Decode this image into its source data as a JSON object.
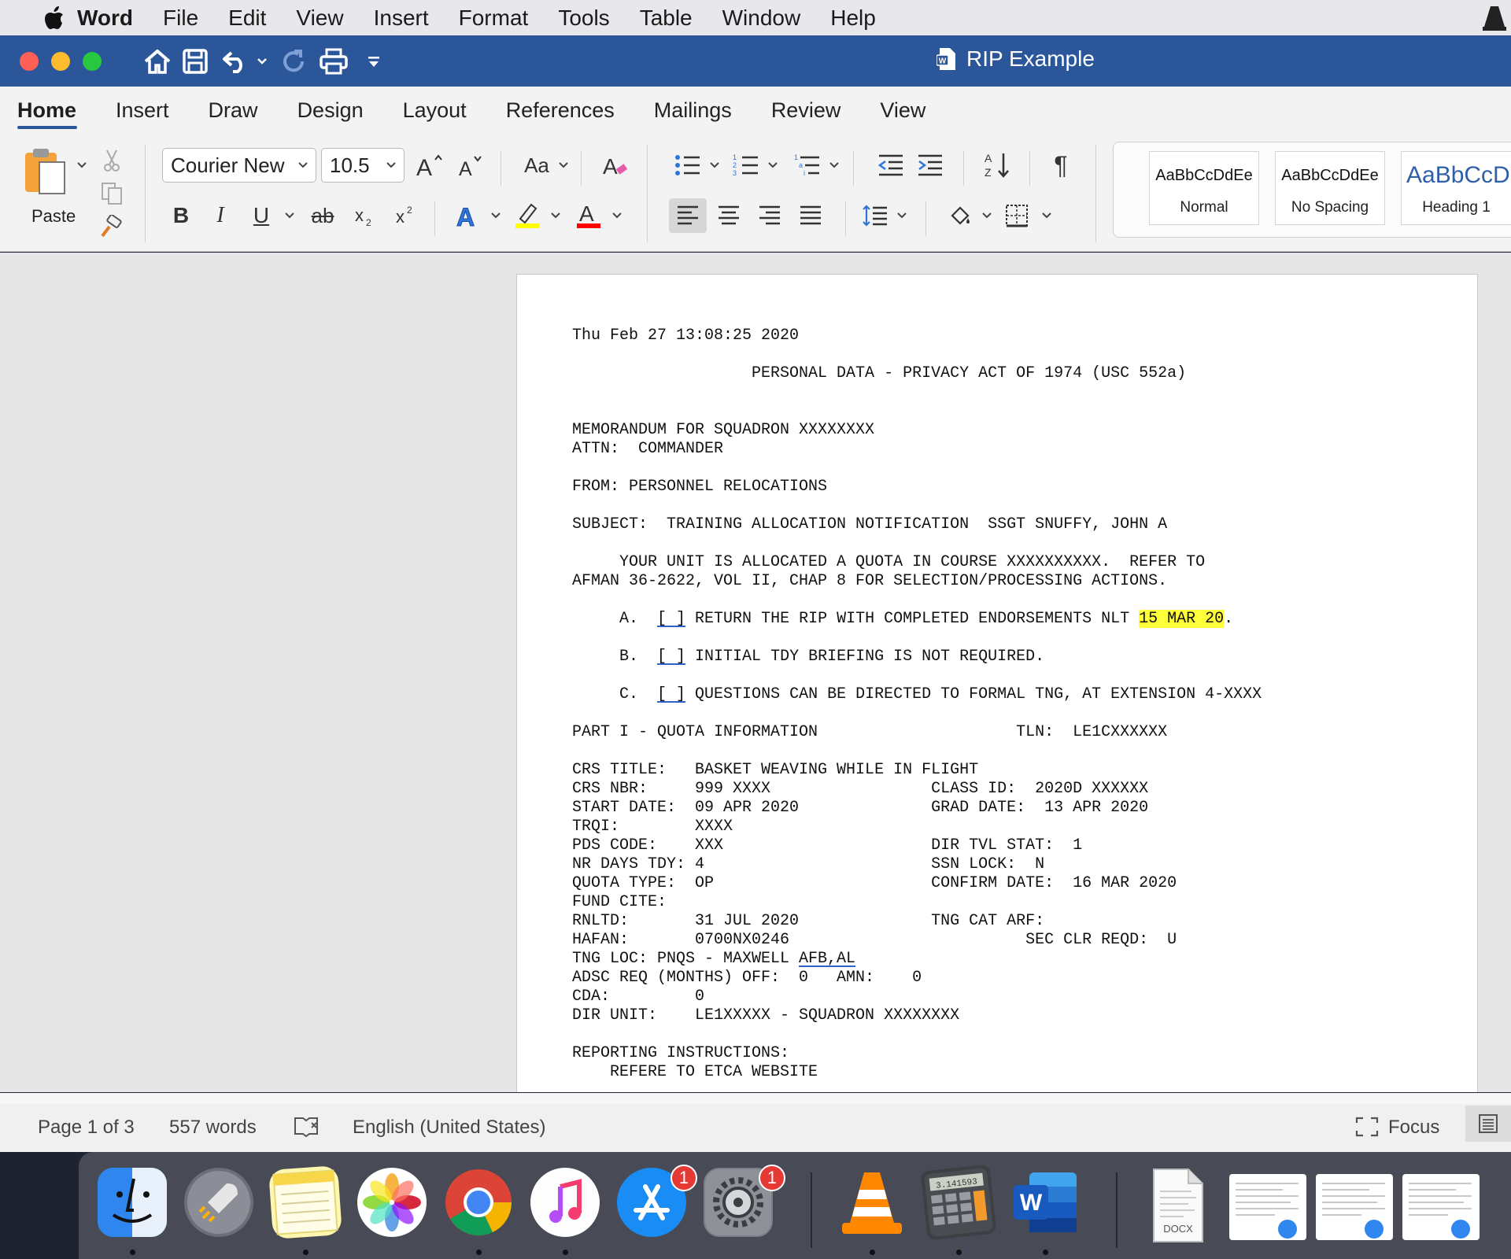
{
  "menubar": {
    "app_name": "Word",
    "items": [
      "File",
      "Edit",
      "View",
      "Insert",
      "Format",
      "Tools",
      "Table",
      "Window",
      "Help"
    ]
  },
  "window": {
    "title": "RIP Example"
  },
  "ribbon": {
    "tabs": [
      "Home",
      "Insert",
      "Draw",
      "Design",
      "Layout",
      "References",
      "Mailings",
      "Review",
      "View"
    ],
    "active_tab": "Home",
    "paste_label": "Paste",
    "font_name": "Courier New",
    "font_size": "10.5",
    "change_case_label": "Aa",
    "styles": [
      {
        "preview": "AaBbCcDdEe",
        "label": "Normal"
      },
      {
        "preview": "AaBbCcDdEe",
        "label": "No Spacing"
      },
      {
        "preview": "AaBbCcDc",
        "label": "Heading 1"
      }
    ],
    "colors": {
      "highlight": "#ffff00",
      "font_color": "#ff0000",
      "text_effect": "#2f75d6"
    }
  },
  "document": {
    "lines": {
      "l01": "Thu Feb 27 13:08:25 2020",
      "l02": "",
      "l03": "                   PERSONAL DATA - PRIVACY ACT OF 1974 (USC 552a)",
      "l04": "",
      "l05": "",
      "l06": "MEMORANDUM FOR SQUADRON XXXXXXXX",
      "l07": "ATTN:  COMMANDER",
      "l08": "",
      "l09": "FROM: PERSONNEL RELOCATIONS",
      "l10": "",
      "l11": "SUBJECT:  TRAINING ALLOCATION NOTIFICATION  SSGT SNUFFY, JOHN A",
      "l12": "",
      "l13": "     YOUR UNIT IS ALLOCATED A QUOTA IN COURSE XXXXXXXXXX.  REFER TO",
      "l14": "AFMAN 36-2622, VOL II, CHAP 8 FOR SELECTION/PROCESSING ACTIONS.",
      "l15": ""
    },
    "item_a": {
      "prefix": "     A.  ",
      "box": "[ ]",
      "text": " RETURN THE RIP WITH COMPLETED ENDORSEMENTS NLT ",
      "highlight": "15 MAR 20",
      "suffix": "."
    },
    "item_b": {
      "prefix": "     B.  ",
      "box": "[ ]",
      "text": " INITIAL TDY BRIEFING IS NOT REQUIRED."
    },
    "item_c": {
      "prefix": "     C.  ",
      "box": "[ ]",
      "text": " QUESTIONS CAN BE DIRECTED TO FORMAL TNG, AT EXTENSION 4-XXXX"
    },
    "lines2": {
      "m01": "PART I - QUOTA INFORMATION                     TLN:  LE1CXXXXXX",
      "m02": "",
      "m03": "CRS TITLE:   BASKET WEAVING WHILE IN FLIGHT",
      "m04": "CRS NBR:     999 XXXX                 CLASS ID:  2020D XXXXXX",
      "m05": "START DATE:  09 APR 2020              GRAD DATE:  13 APR 2020",
      "m06": "TRQI:        XXXX",
      "m07": "PDS CODE:    XXX                      DIR TVL STAT:  1",
      "m08": "NR DAYS TDY: 4                        SSN LOCK:  N",
      "m09": "QUOTA TYPE:  OP                       CONFIRM DATE:  16 MAR 2020",
      "m10": "FUND CITE:",
      "m11": "RNLTD:       31 JUL 2020              TNG CAT ARF:",
      "m12": "HAFAN:       0700NX0246                         SEC CLR REQD:  U"
    },
    "tng_loc": {
      "prefix": "TNG LOC: PNQS - MAXWELL ",
      "underlined": "AFB,AL"
    },
    "lines3": {
      "n01": "ADSC REQ (MONTHS) OFF:  0   AMN:    0",
      "n02": "CDA:         0",
      "n03": "DIR UNIT:    LE1XXXXX - SQUADRON XXXXXXXX",
      "n04": "",
      "n05": "REPORTING INSTRUCTIONS:",
      "n06": "    REFERE TO ETCA WEBSITE"
    }
  },
  "status": {
    "page": "Page 1 of 3",
    "words": "557 words",
    "language": "English (United States)",
    "focus": "Focus"
  },
  "dock": {
    "appstore_badge": "1",
    "settings_badge": "1",
    "calculator_display": "3.141593",
    "docx_label": "DOCX"
  }
}
